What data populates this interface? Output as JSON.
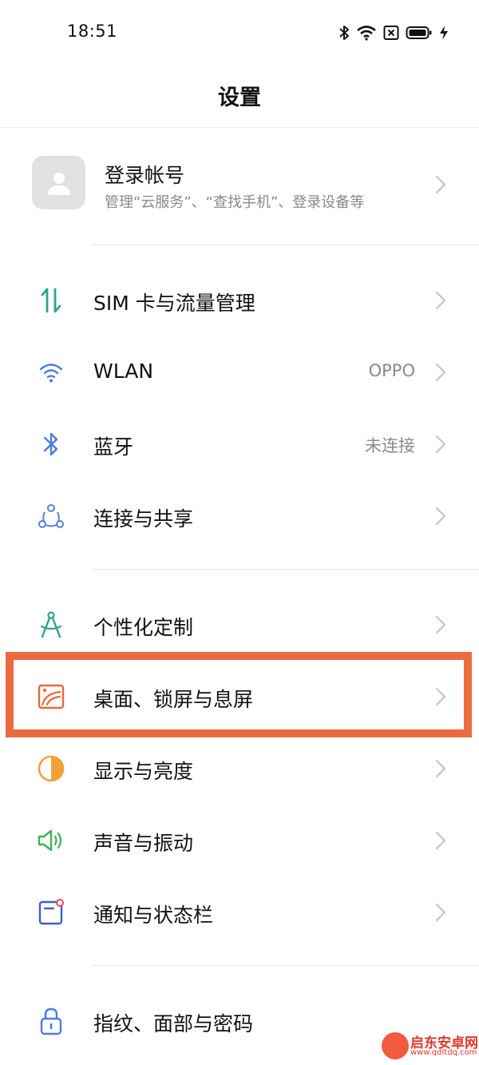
{
  "status_bar": {
    "time": "18:51"
  },
  "header": {
    "title": "设置"
  },
  "account": {
    "name": "登录帐号",
    "subtitle": "管理“云服务”、“查找手机”、登录设备等"
  },
  "settings": [
    {
      "label": "SIM 卡与流量管理",
      "value": "",
      "icon": "sim-data-arrows-icon",
      "color": "#2ba58c"
    },
    {
      "label": "WLAN",
      "value": "OPPO",
      "icon": "wifi-icon",
      "color": "#4a7be0"
    },
    {
      "label": "蓝牙",
      "value": "未连接",
      "icon": "bluetooth-icon",
      "color": "#4a7be0"
    },
    {
      "label": "连接与共享",
      "value": "",
      "icon": "connection-share-icon",
      "color": "#5b7fd6"
    },
    {
      "label": "个性化定制",
      "value": "",
      "icon": "compass-personalize-icon",
      "color": "#2ba58c"
    },
    {
      "label": "桌面、锁屏与息屏",
      "value": "",
      "icon": "wallpaper-icon",
      "color": "#e86a3a"
    },
    {
      "label": "显示与亮度",
      "value": "",
      "icon": "brightness-icon",
      "color": "#f0a23a"
    },
    {
      "label": "声音与振动",
      "value": "",
      "icon": "speaker-icon",
      "color": "#3ab25a"
    },
    {
      "label": "通知与状态栏",
      "value": "",
      "icon": "notification-icon",
      "color": "#3c5ec8"
    },
    {
      "label": "指纹、面部与密码",
      "value": "",
      "icon": "lock-icon",
      "color": "#4a7be0"
    }
  ],
  "highlight_color": "#ec6a3f",
  "watermark": {
    "title": "启东安卓网",
    "url": "www.qdltdq.com"
  }
}
